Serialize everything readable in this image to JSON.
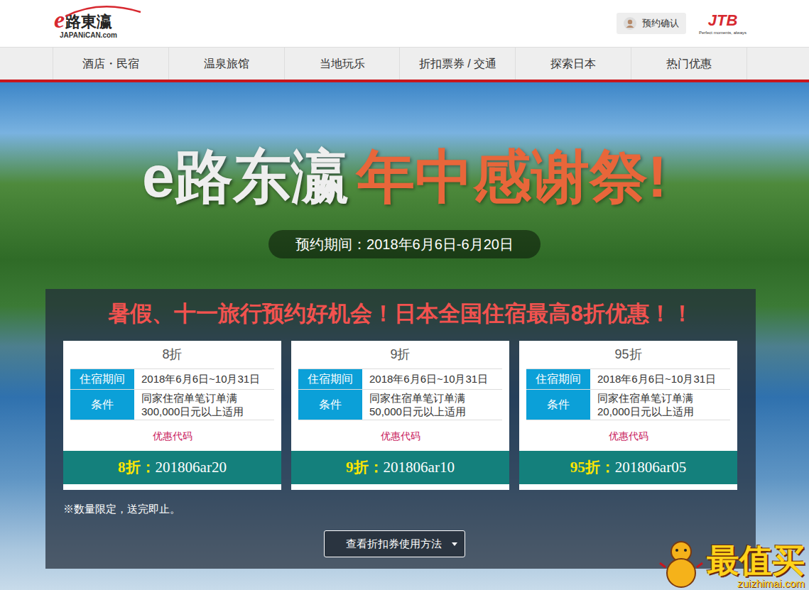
{
  "header": {
    "logo": {
      "mark": "e",
      "text": "路東瀛",
      "sub": "JAPANiCAN.com"
    },
    "booking_button": "预约确认",
    "partner": {
      "name": "JTB",
      "tagline": "Perfect moments, always"
    }
  },
  "nav": [
    "酒店・民宿",
    "温泉旅馆",
    "当地玩乐",
    "折扣票券 / 交通",
    "探索日本",
    "热门优惠"
  ],
  "hero": {
    "title_brand": "e路东瀛",
    "title_event": "年中感谢祭!",
    "period": "预约期间：2018年6月6日-6月20日"
  },
  "promo": {
    "headline": "暑假、十一旅行预约好机会！日本全国住宿最高8折优惠！！",
    "coupons": [
      {
        "discount": "8折",
        "rows": [
          {
            "label": "住宿期间",
            "lines": [
              "2018年6月6日~10月31日"
            ]
          },
          {
            "label": "条件",
            "lines": [
              "同家住宿单笔订单满",
              "300,000日元以上适用"
            ]
          }
        ],
        "code_label": "优惠代码",
        "code_prefix": "8折：",
        "code": "201806ar20"
      },
      {
        "discount": "9折",
        "rows": [
          {
            "label": "住宿期间",
            "lines": [
              "2018年6月6日~10月31日"
            ]
          },
          {
            "label": "条件",
            "lines": [
              "同家住宿单笔订单满",
              "50,000日元以上适用"
            ]
          }
        ],
        "code_label": "优惠代码",
        "code_prefix": "9折：",
        "code": "201806ar10"
      },
      {
        "discount": "95折",
        "rows": [
          {
            "label": "住宿期间",
            "lines": [
              "2018年6月6日~10月31日"
            ]
          },
          {
            "label": "条件",
            "lines": [
              "同家住宿单笔订单满",
              "20,000日元以上适用"
            ]
          }
        ],
        "code_label": "优惠代码",
        "code_prefix": "95折：",
        "code": "201806ar05"
      }
    ],
    "note": "※数量限定，送完即止。",
    "how_to_button": "查看折扣券使用方法"
  },
  "watermark": {
    "main": "最值买",
    "url": "zuizhimai.com"
  }
}
